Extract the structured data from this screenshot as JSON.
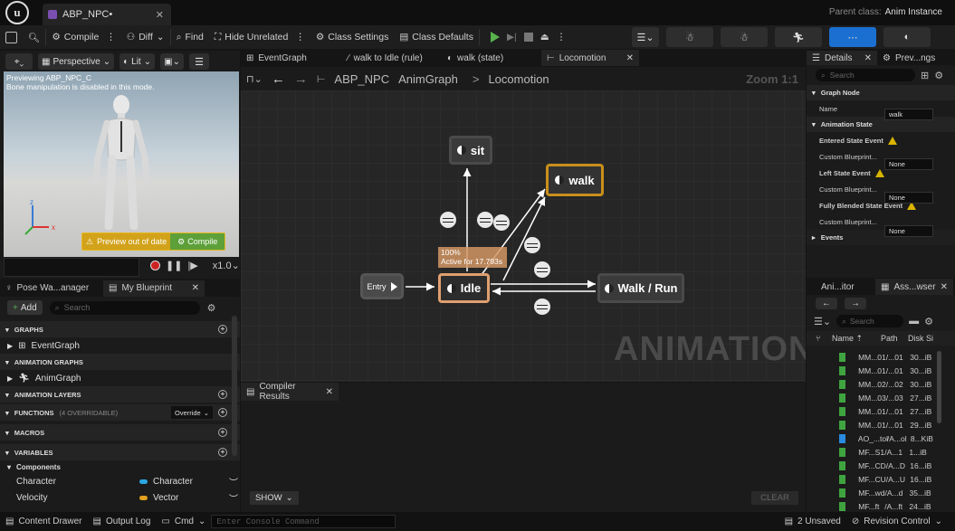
{
  "app": {
    "doc_tab": "ABP_NPC•",
    "parent_class_label": "Parent class:",
    "parent_class_value": "Anim Instance"
  },
  "toolbar": {
    "compile": "Compile",
    "diff": "Diff",
    "find": "Find",
    "hide_unrelated": "Hide Unrelated",
    "class_settings": "Class Settings",
    "class_defaults": "Class Defaults"
  },
  "viewport": {
    "perspective": "Perspective",
    "lit": "Lit",
    "preview_line1": "Previewing ABP_NPC_C",
    "preview_line2": "Bone manipulation is disabled in this mode.",
    "preview_out_of_date": "Preview out of date",
    "compile_btn": "Compile",
    "speed": "x1.0"
  },
  "left_tabs": {
    "pose_watch": "Pose Wa...anager",
    "my_blueprint": "My Blueprint"
  },
  "my_blueprint": {
    "add": "Add",
    "search_placeholder": "Search",
    "graphs_header": "GRAPHS",
    "event_graph": "EventGraph",
    "anim_graphs_header": "ANIMATION GRAPHS",
    "anim_graph": "AnimGraph",
    "anim_layers_header": "ANIMATION LAYERS",
    "functions_header": "FUNCTIONS",
    "functions_count": "(4 OVERRIDABLE)",
    "override": "Override",
    "macros_header": "MACROS",
    "variables_header": "VARIABLES",
    "components": "Components",
    "variables": [
      {
        "name": "Character",
        "type": "Character",
        "color": "#2aa8e0"
      },
      {
        "name": "Velocity",
        "type": "Vector",
        "color": "#e0a020"
      }
    ]
  },
  "graph_tabs": [
    "EventGraph",
    "walk to Idle (rule)",
    "walk (state)",
    "Locomotion"
  ],
  "breadcrumb": {
    "root": "ABP_NPC",
    "mid": "AnimGraph",
    "current": "Locomotion",
    "zoom": "Zoom 1:1"
  },
  "graph": {
    "nodes": {
      "entry": "Entry",
      "idle": "Idle",
      "sit": "sit",
      "walk": "walk",
      "walk_run": "Walk / Run"
    },
    "idle_overlay_line1": "100%",
    "idle_overlay_line2": "Active for 17.793s",
    "watermark": "ANIMATION"
  },
  "compiler": {
    "tab": "Compiler Results",
    "show": "SHOW",
    "clear": "CLEAR"
  },
  "details": {
    "tab1": "Details",
    "tab2": "Prev...ngs",
    "search_placeholder": "Search",
    "graph_node": "Graph Node",
    "name_label": "Name",
    "name_value": "walk",
    "animation_state": "Animation State",
    "entered": "Entered State Event",
    "left": "Left State Event",
    "blended": "Fully Blended State Event",
    "custom_bp": "Custom Blueprint...",
    "none": "None",
    "events": "Events"
  },
  "asset_browser": {
    "tab1": "Ani...itor",
    "tab2": "Ass...wser",
    "search_placeholder": "Search",
    "col_name": "Name",
    "col_path": "Path",
    "col_size": "Disk Si",
    "rows": [
      {
        "name": "MM...01",
        "path": "/...01",
        "size": "30...iB",
        "icon": "#3fa33f"
      },
      {
        "name": "MM...01",
        "path": "/...01",
        "size": "30...iB",
        "icon": "#3fa33f"
      },
      {
        "name": "MM...02",
        "path": "/...02",
        "size": "30...iB",
        "icon": "#3fa33f"
      },
      {
        "name": "MM...03",
        "path": "/...03",
        "size": "27...iB",
        "icon": "#3fa33f"
      },
      {
        "name": "MM...01",
        "path": "/...01",
        "size": "27...iB",
        "icon": "#3fa33f"
      },
      {
        "name": "MM...01",
        "path": "/...01",
        "size": "29...iB",
        "icon": "#3fa33f"
      },
      {
        "name": "AO_...tol",
        "path": "/A...ol",
        "size": "8...KiB",
        "icon": "#2a8adf"
      },
      {
        "name": "MF...S1",
        "path": "/A...1",
        "size": "1...iB",
        "icon": "#3fa33f"
      },
      {
        "name": "MF...CD",
        "path": "/A...D",
        "size": "16...iB",
        "icon": "#3fa33f"
      },
      {
        "name": "MF...CU",
        "path": "/A...U",
        "size": "16...iB",
        "icon": "#3fa33f"
      },
      {
        "name": "MF...wd",
        "path": "/A...d",
        "size": "35...iB",
        "icon": "#3fa33f"
      },
      {
        "name": "MF...ft",
        "path": "/A...ft",
        "size": "24...iB",
        "icon": "#3fa33f"
      }
    ]
  },
  "statusbar": {
    "content_drawer": "Content Drawer",
    "output_log": "Output Log",
    "cmd": "Cmd",
    "console_placeholder": "Enter Console Command",
    "unsaved": "2 Unsaved",
    "revision": "Revision Control"
  }
}
